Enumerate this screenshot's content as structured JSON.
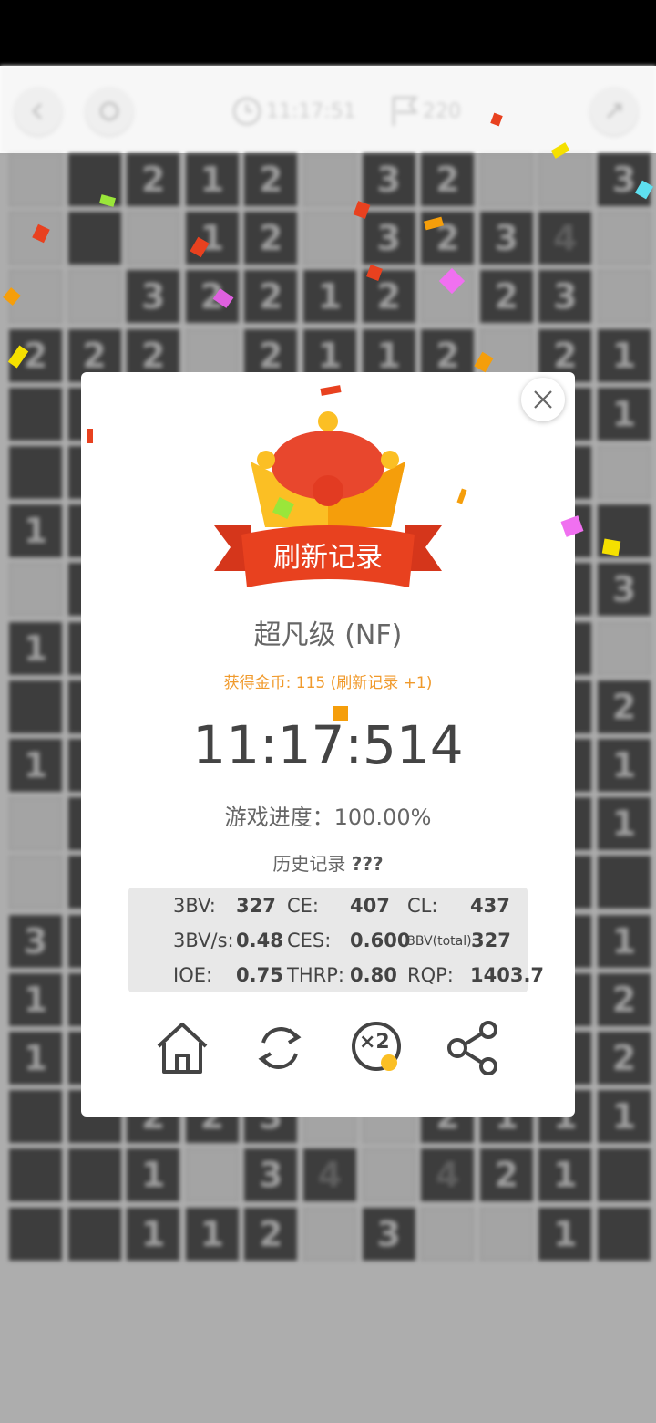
{
  "toolbar": {
    "timer": "11:17:51",
    "flags": "220"
  },
  "board": {
    "rows": [
      [
        "",
        "",
        "2",
        "1",
        "2",
        "",
        "3",
        "2",
        "",
        "",
        "3"
      ],
      [
        "",
        "",
        "",
        "1",
        "2",
        "",
        "3",
        "2",
        "3",
        "4",
        ""
      ],
      [
        "",
        "",
        "3",
        "2",
        "2",
        "1",
        "2",
        "",
        "2",
        "3",
        ""
      ],
      [
        "2",
        "2",
        "2",
        "",
        "2",
        "1",
        "1",
        "2",
        "",
        "2",
        "1"
      ],
      [
        "",
        "",
        "",
        "",
        "",
        "",
        "",
        "",
        "",
        "",
        "1"
      ],
      [
        "",
        "",
        "",
        "",
        "",
        "",
        "",
        "",
        "",
        "",
        ""
      ],
      [
        "1",
        "",
        "",
        "",
        "",
        "",
        "",
        "",
        "",
        "",
        ""
      ],
      [
        "",
        "",
        "",
        "",
        "",
        "",
        "",
        "",
        "",
        "",
        "3"
      ],
      [
        "1",
        "",
        "",
        "",
        "",
        "",
        "",
        "",
        "",
        "",
        ""
      ],
      [
        "",
        "",
        "",
        "",
        "",
        "",
        "",
        "",
        "",
        "",
        "2"
      ],
      [
        "1",
        "",
        "",
        "",
        "",
        "",
        "",
        "",
        "",
        "",
        "1"
      ],
      [
        "",
        "",
        "",
        "",
        "",
        "",
        "",
        "",
        "",
        "",
        "1"
      ],
      [
        "",
        "",
        "",
        "",
        "",
        "",
        "",
        "",
        "",
        "",
        ""
      ],
      [
        "3",
        "",
        "",
        "",
        "",
        "",
        "",
        "",
        "",
        "",
        "1"
      ],
      [
        "1",
        "",
        "",
        "",
        "",
        "",
        "",
        "",
        "",
        "",
        "2"
      ],
      [
        "1",
        "",
        "",
        "",
        "",
        "",
        "",
        "",
        "",
        "",
        "2"
      ],
      [
        "",
        "",
        "2",
        "2",
        "3",
        "",
        "",
        "2",
        "1",
        "1",
        "1"
      ],
      [
        "",
        "",
        "1",
        "",
        "3",
        "4",
        "",
        "4",
        "2",
        "1",
        ""
      ],
      [
        "",
        "",
        "1",
        "1",
        "2",
        "",
        "3",
        "",
        "",
        "1",
        ""
      ]
    ]
  },
  "dialog": {
    "banner": "刷新记录",
    "level": "超凡级 (NF)",
    "coins": "获得金币: 115 (刷新记录 +1)",
    "time": "11:17:514",
    "progress": "游戏进度：100.00%",
    "history_label": "历史记录",
    "history_value": "???",
    "stats": {
      "bv_label": "3BV:",
      "bv": "327",
      "ce_label": "CE:",
      "ce": "407",
      "cl_label": "CL:",
      "cl": "437",
      "bvs_label": "3BV/s:",
      "bvs": "0.48",
      "ces_label": "CES:",
      "ces": "0.600",
      "bvtotal_label": "3BV(total):",
      "bvtotal": "327",
      "ioe_label": "IOE:",
      "ioe": "0.75",
      "thrp_label": "THRP:",
      "thrp": "0.80",
      "rqp_label": "RQP:",
      "rqp": "1403.7"
    },
    "double_label": "×2"
  },
  "colors": {
    "accent_orange": "#f09a2c",
    "banner_red": "#e8411f",
    "crown_gold": "#fbbf24"
  },
  "icons": [
    "back-icon",
    "restart-icon",
    "clock-icon",
    "flag-icon",
    "expand-icon",
    "close-icon",
    "home-icon",
    "refresh-icon",
    "double-coins-icon",
    "share-icon",
    "crown-icon"
  ]
}
